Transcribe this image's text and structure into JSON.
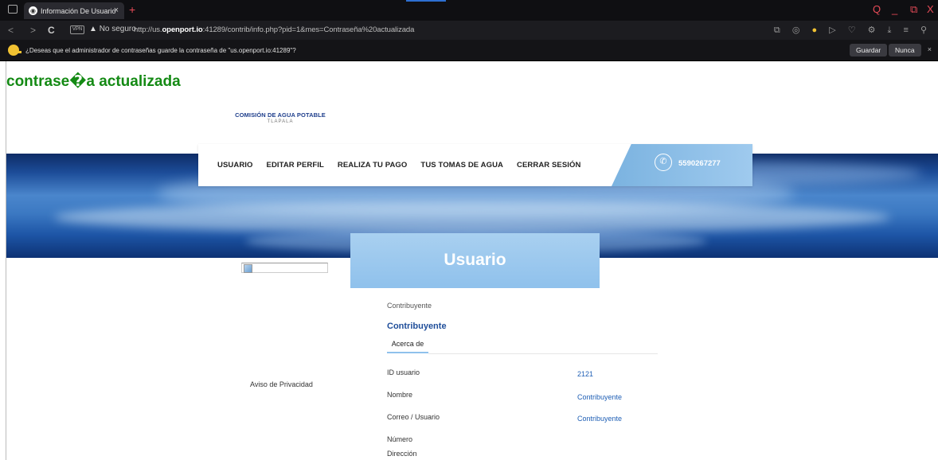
{
  "browser": {
    "tab_title": "Información De Usuario",
    "tab_close": "×",
    "new_tab": "+",
    "url_prefix": "http://us.",
    "url_domain": "openport.io",
    "url_rest": ":41289/contrib/info.php?pid=1&mes=Contraseña%20actualizada",
    "security_label": "No seguro",
    "vpn_label": "VPN",
    "nav": {
      "back": "<",
      "forward": ">",
      "reload": "C"
    },
    "window": {
      "search": "Q",
      "minimize": "_",
      "restore": "⧉",
      "close": "X"
    },
    "accent_color": "#e84b58"
  },
  "password_prompt": {
    "message": "¿Deseas que el administrador de contraseñas guarde la contraseña de \"us.openport.io:41289\"?",
    "save_label": "Guardar",
    "never_label": "Nunca",
    "close": "×"
  },
  "page": {
    "status_message": "contrase�a actualizada",
    "logo_line1": "COMISIÓN DE AGUA POTABLE",
    "logo_line2": "TLAPALA",
    "menu": [
      "USUARIO",
      "EDITAR PERFIL",
      "REALIZA TU PAGO",
      "TUS TOMAS DE AGUA",
      "CERRAR SESIÓN"
    ],
    "phone": "5590267277",
    "section_title": "Usuario",
    "privacy_link": "Aviso de Privacidad",
    "role_label": "Contribuyente",
    "role_name": "Contribuyente",
    "about_tab": "Acerca de",
    "fields": [
      {
        "label": "ID usuario",
        "value": "2121"
      },
      {
        "label": "Nombre",
        "value": "Contribuyente"
      },
      {
        "label": "Correo / Usuario",
        "value": "Contribuyente"
      },
      {
        "label": "Número",
        "value": ""
      },
      {
        "label": "Dirección",
        "value": ""
      }
    ],
    "brand_color": "#1f4e9a",
    "success_color": "#148a14"
  }
}
